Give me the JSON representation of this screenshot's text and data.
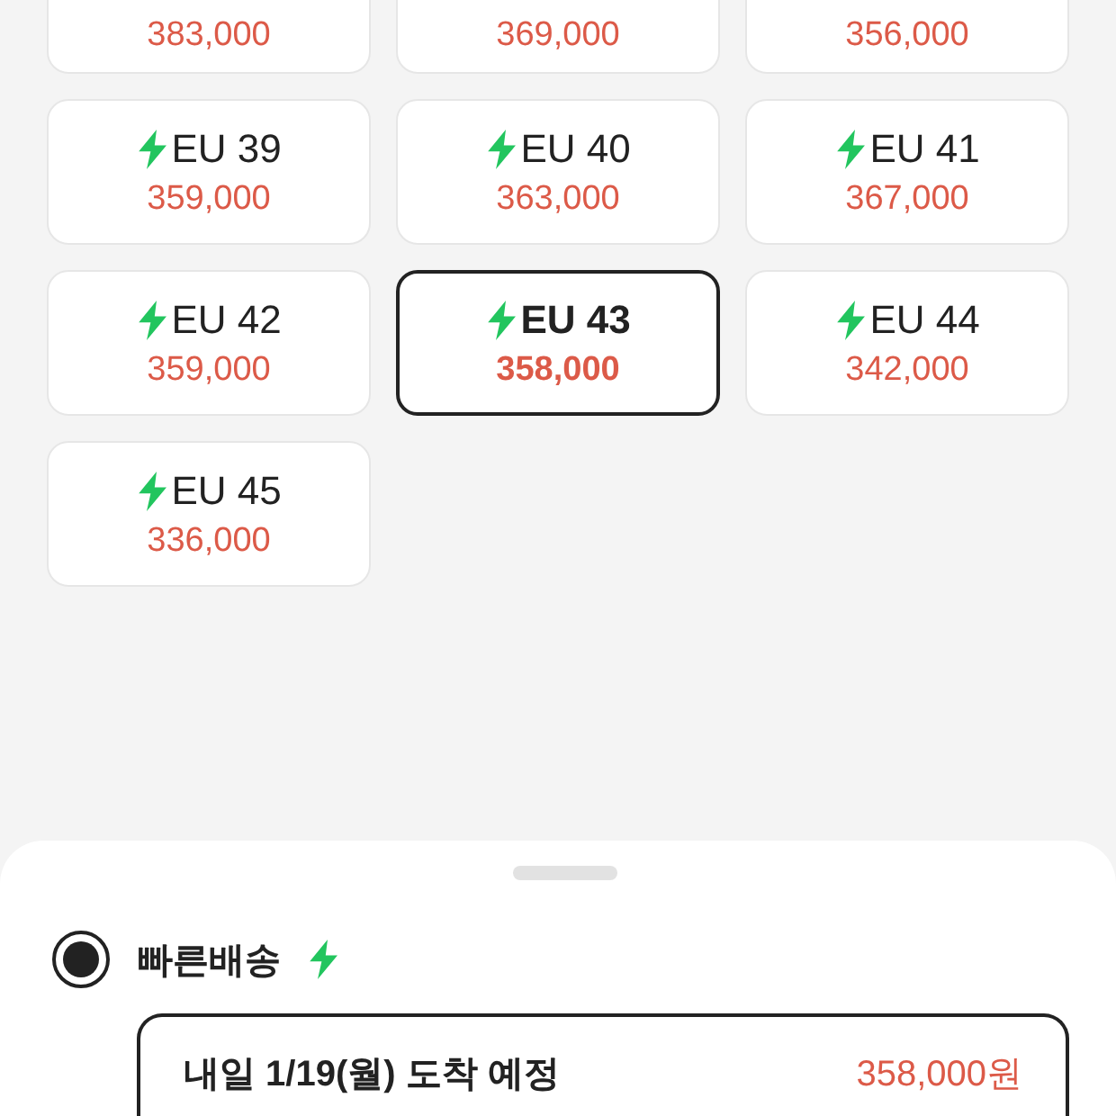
{
  "sizes": [
    {
      "price": "383,000",
      "selected": false
    },
    {
      "price": "369,000",
      "selected": false
    },
    {
      "price": "356,000",
      "selected": false
    },
    {
      "label": "EU 39",
      "fast": true,
      "price": "359,000",
      "selected": false
    },
    {
      "label": "EU 40",
      "fast": true,
      "price": "363,000",
      "selected": false
    },
    {
      "label": "EU 41",
      "fast": true,
      "price": "367,000",
      "selected": false
    },
    {
      "label": "EU 42",
      "fast": true,
      "price": "359,000",
      "selected": false
    },
    {
      "label": "EU 43",
      "fast": true,
      "price": "358,000",
      "selected": true
    },
    {
      "label": "EU 44",
      "fast": true,
      "price": "342,000",
      "selected": false
    },
    {
      "label": "EU 45",
      "fast": true,
      "price": "336,000",
      "selected": false
    }
  ],
  "sheet": {
    "option": {
      "label": "빠른배송",
      "fast": true,
      "selected": true
    },
    "delivery": {
      "date": "내일 1/19(월) 도착 예정",
      "price": "358,000원"
    }
  }
}
